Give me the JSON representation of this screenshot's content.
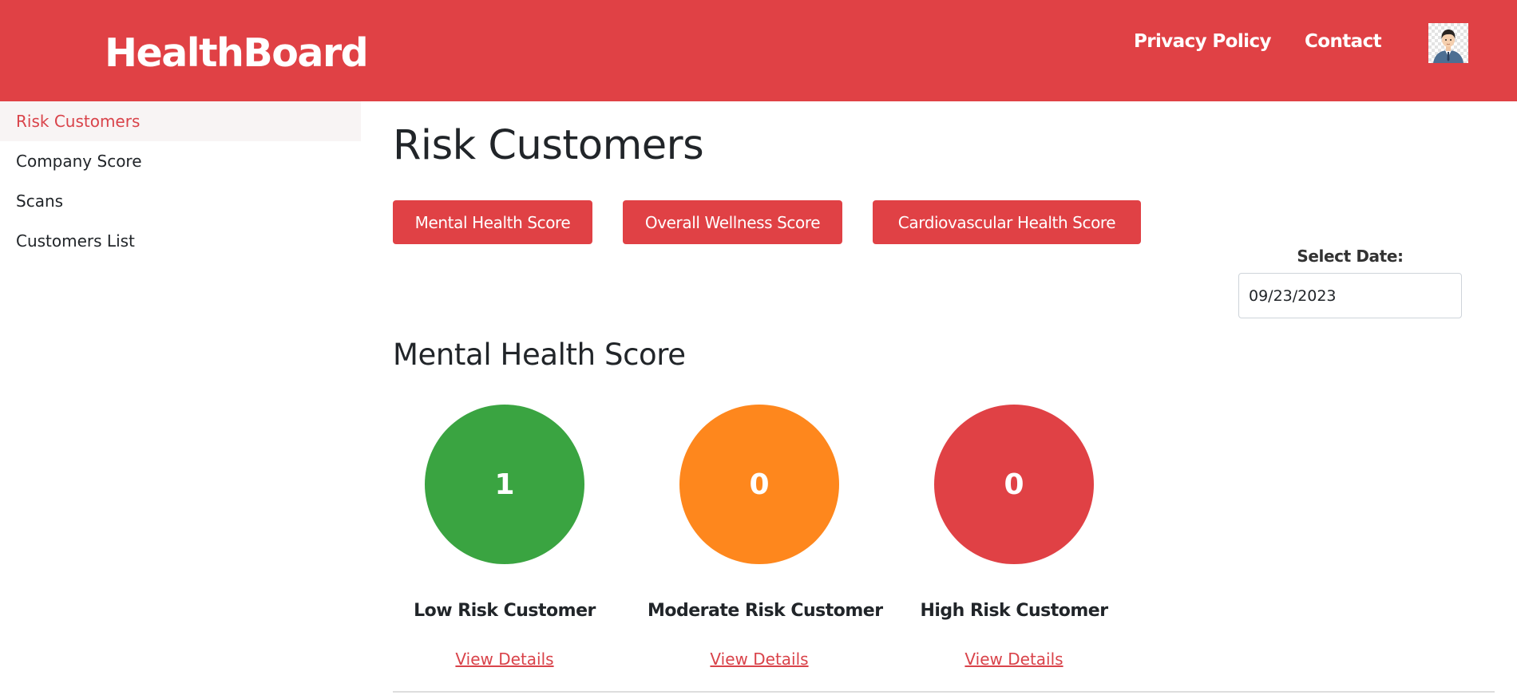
{
  "header": {
    "brand": "HealthBoard",
    "nav": {
      "privacy": "Privacy Policy",
      "contact": "Contact"
    }
  },
  "sidebar": {
    "items": [
      {
        "label": "Risk Customers",
        "active": true
      },
      {
        "label": "Company Score",
        "active": false
      },
      {
        "label": "Scans",
        "active": false
      },
      {
        "label": "Customers List",
        "active": false
      }
    ]
  },
  "main": {
    "title": "Risk Customers",
    "tabs": [
      {
        "label": "Mental Health Score"
      },
      {
        "label": "Overall Wellness Score"
      },
      {
        "label": "Cardiovascular Health Score"
      }
    ],
    "date": {
      "label": "Select Date:",
      "value": "09/23/2023"
    },
    "section_title": "Mental Health Score",
    "risk_cards": [
      {
        "count": "1",
        "label": "Low Risk Customer",
        "link": "View Details",
        "color": "#3aa441"
      },
      {
        "count": "0",
        "label": "Moderate Risk Customer",
        "link": "View Details",
        "color": "#fe871d"
      },
      {
        "count": "0",
        "label": "High Risk Customer",
        "link": "View Details",
        "color": "#e04145"
      }
    ]
  },
  "colors": {
    "brand": "#e04145",
    "accent_text": "#d9434a"
  }
}
